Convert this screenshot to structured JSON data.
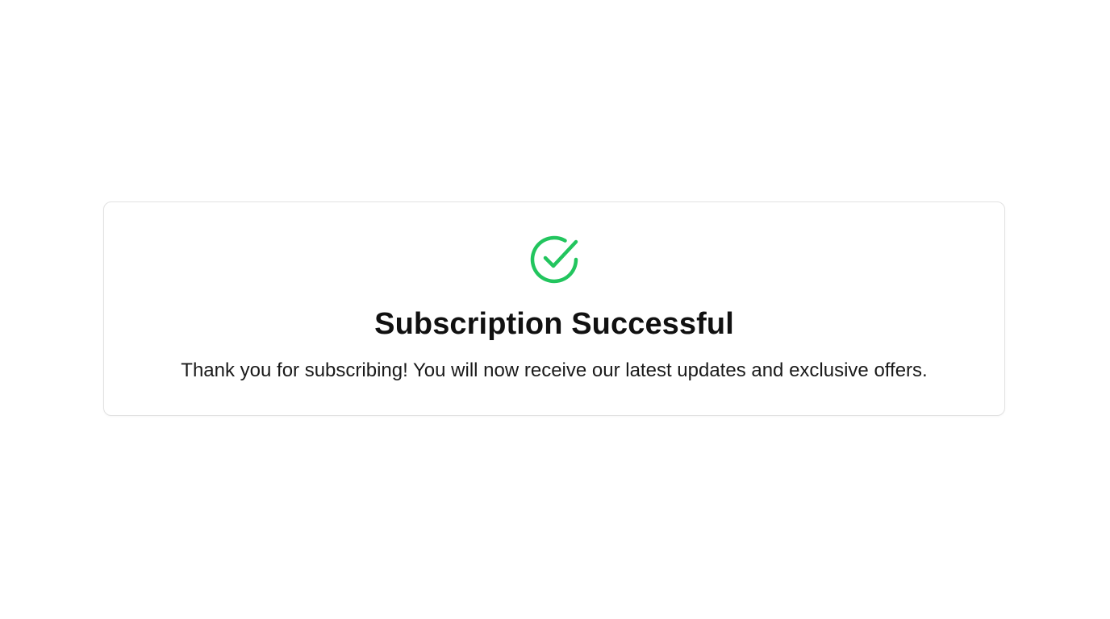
{
  "confirmation": {
    "icon": "check-circle-icon",
    "icon_color": "#22c55e",
    "title": "Subscription Successful",
    "message": "Thank you for subscribing! You will now receive our latest updates and exclusive offers."
  }
}
